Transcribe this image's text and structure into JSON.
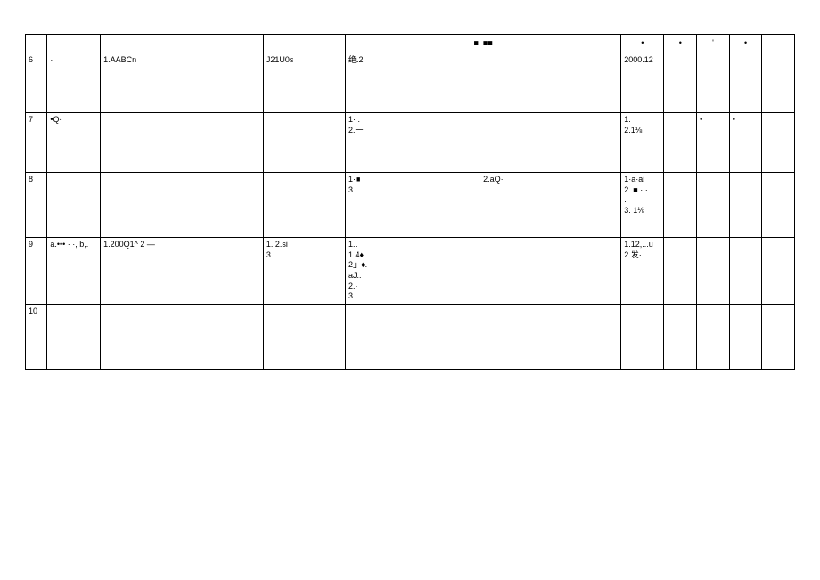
{
  "header": {
    "c5": "■. ■■",
    "c6": "•",
    "c7": "•",
    "c8": "'",
    "c9": "•",
    "c10": "."
  },
  "rows": [
    {
      "n": "6",
      "c2": "·",
      "c3": "1.AABCn",
      "c4": "J21U0s",
      "c5": "绝.2",
      "c6": "2000.12",
      "c7": "",
      "c8": "",
      "c9": "",
      "c10": ""
    },
    {
      "n": "7",
      "c2": "•Q-",
      "c3": "",
      "c4": "",
      "c5": "1· .\n2.一",
      "c6": "1.\n2.1⅛",
      "c7": "",
      "c8": "•",
      "c9": "•",
      "c10": ""
    },
    {
      "n": "8",
      "c2": "",
      "c3": "",
      "c4": "",
      "c5a": "1·■\n3..",
      "c5b": "2.aQ·",
      "c6": "1·a·ai\n2.  ■ · ·\n.\n3.   1⅛",
      "c7": "",
      "c8": "",
      "c9": "",
      "c10": ""
    },
    {
      "n": "9",
      "c2": "a.••• · ·,  b,.",
      "c3": "1.200Q1^                     2 —",
      "c4": "1.                    2.si\n3..",
      "c5": "1..\n1.4♦.\n2」♦.\naJ..\n2.·\n3..",
      "c6": "1.12,...u\n2.发·..",
      "c7": "",
      "c8": "",
      "c9": "",
      "c10": ""
    },
    {
      "n": "10",
      "c2": "",
      "c3": "",
      "c4": "",
      "c5": "",
      "c6": "",
      "c7": "",
      "c8": "",
      "c9": "",
      "c10": ""
    }
  ]
}
